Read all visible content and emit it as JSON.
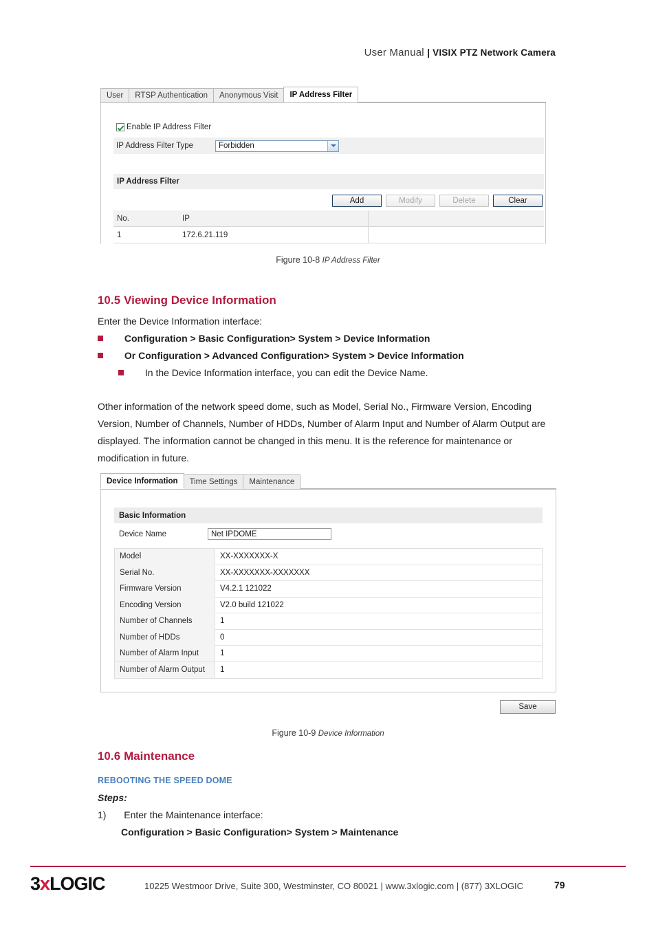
{
  "header": {
    "title_light": "User Manual ",
    "title_bold": "| VISIX PTZ Network Camera"
  },
  "figure_ipfilter": {
    "tabs": [
      {
        "label": "User",
        "active": false
      },
      {
        "label": "RTSP Authentication",
        "active": false
      },
      {
        "label": "Anonymous Visit",
        "active": false
      },
      {
        "label": "IP Address Filter",
        "active": true
      }
    ],
    "enable_checkbox_label": "Enable IP Address Filter",
    "enable_checkbox_checked": true,
    "filter_type_label": "IP Address Filter Type",
    "filter_type_value": "Forbidden",
    "section_title": "IP Address Filter",
    "buttons": [
      {
        "label": "Add",
        "state": "enabled"
      },
      {
        "label": "Modify",
        "state": "disabled"
      },
      {
        "label": "Delete",
        "state": "disabled"
      },
      {
        "label": "Clear",
        "state": "enabled"
      }
    ],
    "table": {
      "headers": [
        "No.",
        "IP"
      ],
      "rows": [
        [
          "1",
          "172.6.21.119"
        ]
      ]
    },
    "caption_prefix": "Figure 10-8 ",
    "caption_italic": "IP Address Filter"
  },
  "section_10_5": {
    "number": "10.5",
    "title": "Viewing Device Information",
    "intro": "Enter the Device Information interface:",
    "bullets": [
      "Configuration > Basic Configuration> System > Device Information",
      "Or Configuration > Advanced Configuration> System > Device Information"
    ],
    "sub_bullet": "In the Device Information interface, you can edit the Device Name.",
    "paragraph": "Other information of the network speed dome, such as Model, Serial No., Firmware Version, Encoding Version, Number of Channels, Number of HDDs, Number of Alarm Input and Number of Alarm Output are displayed. The information cannot be changed in this menu. It is the reference for maintenance or modification in future."
  },
  "figure_devinfo": {
    "tabs": [
      {
        "label": "Device Information",
        "active": true
      },
      {
        "label": "Time Settings",
        "active": false
      },
      {
        "label": "Maintenance",
        "active": false
      }
    ],
    "basic_information_title": "Basic Information",
    "device_name_label": "Device Name",
    "device_name_value": "Net IPDOME",
    "rows": [
      {
        "key": "Model",
        "value": "XX-XXXXXXX-X"
      },
      {
        "key": "Serial No.",
        "value": "XX-XXXXXXX-XXXXXXX"
      },
      {
        "key": "Firmware Version",
        "value": "V4.2.1 121022"
      },
      {
        "key": "Encoding Version",
        "value": "V2.0 build 121022"
      },
      {
        "key": "Number of Channels",
        "value": "1"
      },
      {
        "key": "Number of HDDs",
        "value": "0"
      },
      {
        "key": "Number of Alarm Input",
        "value": "1"
      },
      {
        "key": "Number of Alarm Output",
        "value": "1"
      }
    ],
    "save_label": "Save",
    "caption_prefix": "Figure 10-9 ",
    "caption_italic": "Device Information"
  },
  "section_10_6": {
    "number": "10.6",
    "title": "Maintenance",
    "subheading": "REBOOTING THE SPEED DOME",
    "steps_label": "Steps:",
    "step1_number": "1)",
    "step1_text": "Enter the Maintenance interface:",
    "step1_path": "Configuration > Basic Configuration> System > Maintenance"
  },
  "footer": {
    "logo_pre": "3",
    "logo_x": "x",
    "logo_post": "LOGIC",
    "address": "10225 Westmoor Drive, Suite 300, Westminster, CO 80021 | www.3xlogic.com | (877) 3XLOGIC",
    "page_number": "79"
  }
}
